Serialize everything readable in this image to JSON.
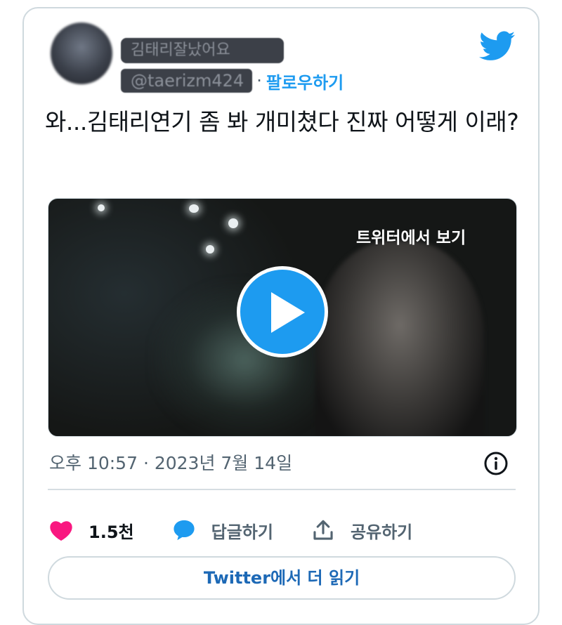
{
  "header": {
    "display_name": "김태리잘났어요",
    "handle": "@taerizm424",
    "separator": "·",
    "follow_label": "팔로우하기"
  },
  "tweet": {
    "text": "와...김태리연기 좀 봐 개미쳤다 진짜 어떻게 이래?"
  },
  "media": {
    "overlay_label": "트위터에서 보기"
  },
  "meta": {
    "timestamp": "오후 10:57 · 2023년 7월 14일"
  },
  "actions": {
    "like_count": "1.5천",
    "reply_label": "답글하기",
    "share_label": "공유하기"
  },
  "footer": {
    "read_more_label": "Twitter에서 더 읽기"
  },
  "colors": {
    "accent": "#1d9bf0",
    "like": "#f91880",
    "muted": "#536471"
  },
  "icons": [
    "twitter-logo-icon",
    "play-icon",
    "info-icon",
    "heart-icon",
    "reply-bubble-icon",
    "share-icon"
  ]
}
